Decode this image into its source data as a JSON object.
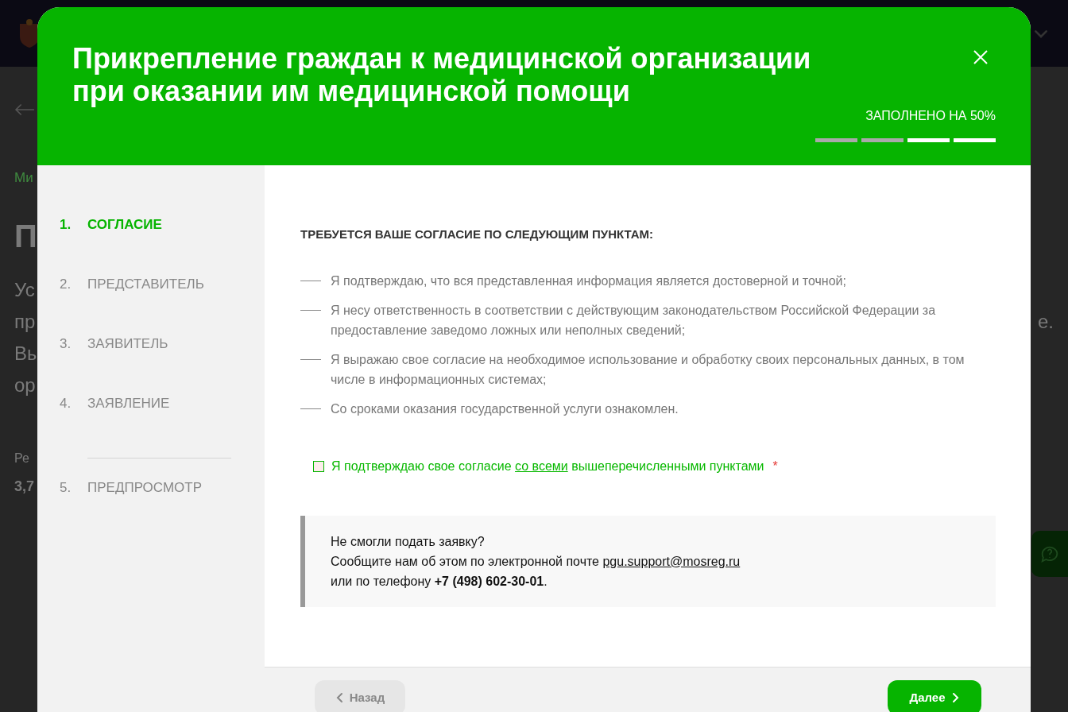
{
  "background_page": {
    "breadcrumb": "Ми",
    "heading": "П",
    "text_lines": [
      "Ус",
      "пр",
      "Вы",
      "ор"
    ],
    "text_line_end": "е.",
    "rating_label": "Ре",
    "rating_value": "3,7"
  },
  "modal": {
    "title": "Прикрепление граждан к медицинской организации при оказании им медицинской помощи",
    "progress": {
      "label": "ЗАПОЛНЕНО НА 50%",
      "level": 0.5
    },
    "steps": [
      {
        "number": "1.",
        "label": "СОГЛАСИЕ",
        "selected": true
      },
      {
        "number": "2.",
        "label": "ПРЕДСТАВИТЕЛЬ",
        "selected": false
      },
      {
        "number": "3.",
        "label": "ЗАЯВИТЕЛЬ",
        "selected": false
      },
      {
        "number": "4.",
        "label": "ЗАЯВЛЕНИЕ",
        "selected": false
      },
      {
        "number": "5.",
        "label": "ПРЕДПРОСМОТР",
        "selected": false
      }
    ],
    "consent_heading": "ТРЕБУЕТСЯ ВАШЕ СОГЛАСИЕ ПО СЛЕДУЮЩИМ ПУНКТАМ:",
    "consent_items": [
      "Я подтверждаю, что вся представленная информация является достоверной и точной;",
      "Я несу ответственность в соответствии с действующим законодательством Российской Федерации за предоставление заведомо ложных или неполных сведений;",
      "Я выражаю свое согласие на необходимое использование и обработку своих персональных данных, в том числе в информационных системах;",
      "Со сроками оказания государственной услуги ознакомлен."
    ],
    "agreement": {
      "checked": false,
      "text_before": "Я подтверждаю свое согласие",
      "link": "со всеми",
      "text_after": "вышеперечисленными пунктами",
      "required_mark": "*"
    },
    "help": {
      "line_1": "Не смогли подать заявку?",
      "line_2": "Сообщите нам об этом по электронной почте",
      "email": "pgu.support@mosreg.ru",
      "line_3": "или по телефону **+7 (498) 602-30-01**."
    },
    "buttons": {
      "back": {
        "label": "Назад",
        "disabled": true
      },
      "next": {
        "label": "Далее",
        "disabled": false
      }
    }
  }
}
